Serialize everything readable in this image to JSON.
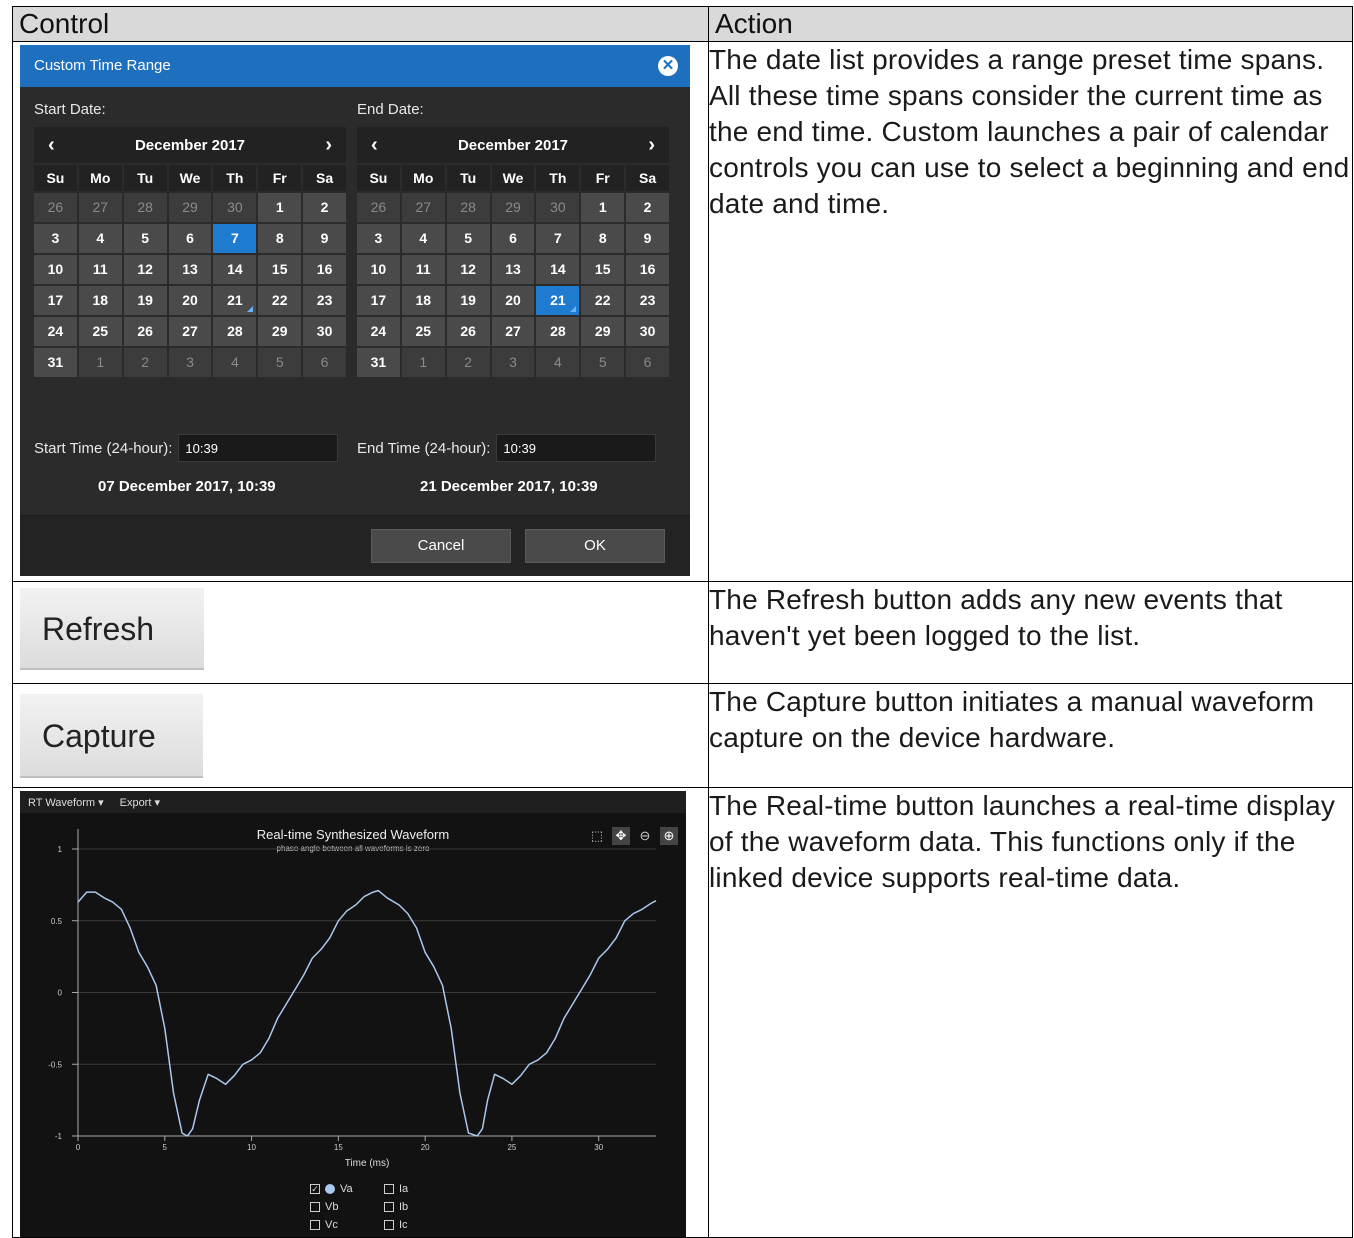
{
  "table": {
    "header_control": "Control",
    "header_action": "Action"
  },
  "rows": [
    {
      "action": "The date list provides a range preset time spans. All these time spans consider the current time as the end time. Custom launches a pair of calendar controls you can use to select a beginning and end date and time."
    },
    {
      "action": "The Refresh button adds any new events that haven't yet been logged to the list."
    },
    {
      "action": "The Capture button initiates a manual waveform capture on the device hardware."
    },
    {
      "action": "The Real-time button launches a real-time display of the waveform data. This functions only if the linked device supports real-time data."
    }
  ],
  "dialog": {
    "title": "Custom Time Range",
    "close_icon": "close-icon",
    "start_label": "Start Date:",
    "end_label": "End Date:",
    "start_month": "December 2017",
    "end_month": "December 2017",
    "prev_icon": "‹",
    "next_icon": "›",
    "days_of_week": [
      "Su",
      "Mo",
      "Tu",
      "We",
      "Th",
      "Fr",
      "Sa"
    ],
    "weeks": [
      [
        "26",
        "27",
        "28",
        "29",
        "30",
        "1",
        "2"
      ],
      [
        "3",
        "4",
        "5",
        "6",
        "7",
        "8",
        "9"
      ],
      [
        "10",
        "11",
        "12",
        "13",
        "14",
        "15",
        "16"
      ],
      [
        "17",
        "18",
        "19",
        "20",
        "21",
        "22",
        "23"
      ],
      [
        "24",
        "25",
        "26",
        "27",
        "28",
        "29",
        "30"
      ],
      [
        "31",
        "1",
        "2",
        "3",
        "4",
        "5",
        "6"
      ]
    ],
    "start_selected": "7",
    "end_selected": "21",
    "today": "21",
    "start_time_label": "Start Time (24-hour):",
    "end_time_label": "End Time (24-hour):",
    "start_time": "10:39",
    "end_time": "10:39",
    "start_summary": "07 December 2017, 10:39",
    "end_summary": "21 December 2017, 10:39",
    "cancel_label": "Cancel",
    "ok_label": "OK",
    "accent_color": "#1f6fbf"
  },
  "refresh_button": {
    "label": "Refresh"
  },
  "capture_button": {
    "label": "Capture"
  },
  "waveform": {
    "menu_rt": "RT Waveform ▾",
    "menu_export": "Export ▾",
    "tools": [
      "select-icon",
      "pan-icon",
      "zoom-out-icon",
      "zoom-in-icon"
    ],
    "legend": [
      {
        "label": "Va",
        "checked": true
      },
      {
        "label": "Ia",
        "checked": false
      },
      {
        "label": "Vb",
        "checked": false
      },
      {
        "label": "Ib",
        "checked": false
      },
      {
        "label": "Vc",
        "checked": false
      },
      {
        "label": "Ic",
        "checked": false
      }
    ]
  },
  "chart_data": {
    "type": "line",
    "title": "Real-time Synthesized Waveform",
    "subtitle": "phase angle between all waveforms is zero",
    "xlabel": "Time (ms)",
    "ylabel": "",
    "xlim": [
      0,
      33.3
    ],
    "ylim": [
      -1,
      1
    ],
    "x_ticks": [
      "0",
      "5",
      "10",
      "15",
      "20",
      "25",
      "30"
    ],
    "y_ticks": [
      "1",
      "0.5",
      "0",
      "-0.5",
      "-1"
    ],
    "grid": true,
    "series": [
      {
        "name": "Va",
        "color": "#a9c8ec",
        "x": [
          0,
          0.5,
          1.0,
          1.5,
          2.0,
          2.5,
          3.0,
          3.5,
          4.0,
          4.5,
          5.0,
          5.5,
          6.0,
          6.3,
          6.6,
          7.0,
          7.5,
          8.0,
          8.5,
          9.0,
          9.5,
          10.0,
          10.5,
          11.0,
          11.5,
          12.0,
          12.5,
          13.0,
          13.5,
          14.0,
          14.5,
          15.0,
          15.5,
          16.0,
          16.5,
          17.0,
          17.3,
          17.8,
          18.5,
          19.0,
          19.5,
          20.0,
          20.5,
          21.0,
          21.5,
          22.0,
          22.5,
          23.0,
          23.3,
          23.6,
          24.0,
          24.5,
          25.0,
          25.5,
          26.0,
          26.5,
          27.0,
          27.5,
          28.0,
          28.5,
          29.0,
          29.5,
          30.0,
          30.5,
          31.0,
          31.5,
          32.0,
          32.5,
          33.0,
          33.3
        ],
        "values": [
          0.63,
          0.7,
          0.7,
          0.66,
          0.63,
          0.58,
          0.45,
          0.28,
          0.18,
          0.05,
          -0.25,
          -0.7,
          -0.98,
          -1.0,
          -0.95,
          -0.75,
          -0.57,
          -0.6,
          -0.64,
          -0.58,
          -0.5,
          -0.47,
          -0.42,
          -0.32,
          -0.18,
          -0.08,
          0.02,
          0.12,
          0.24,
          0.3,
          0.38,
          0.5,
          0.57,
          0.61,
          0.67,
          0.7,
          0.71,
          0.66,
          0.61,
          0.55,
          0.45,
          0.28,
          0.18,
          0.05,
          -0.25,
          -0.7,
          -0.98,
          -1.0,
          -0.95,
          -0.75,
          -0.57,
          -0.6,
          -0.64,
          -0.58,
          -0.5,
          -0.47,
          -0.42,
          -0.32,
          -0.18,
          -0.08,
          0.02,
          0.12,
          0.24,
          0.3,
          0.38,
          0.5,
          0.55,
          0.58,
          0.62,
          0.64
        ]
      }
    ]
  }
}
